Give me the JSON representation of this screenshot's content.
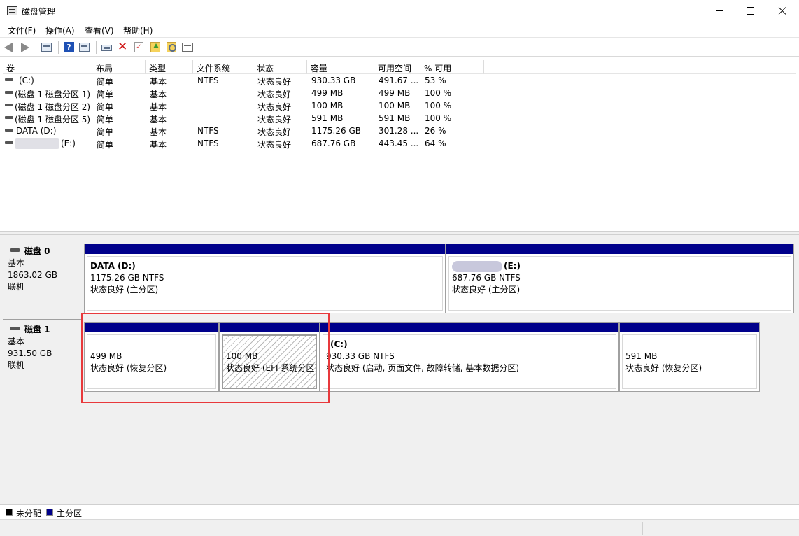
{
  "window": {
    "title": "磁盘管理"
  },
  "menu": [
    "文件(F)",
    "操作(A)",
    "查看(V)",
    "帮助(H)"
  ],
  "toolbar": {
    "icons": [
      "back-arrow",
      "forward-arrow",
      "show-hide-console-tree",
      "help",
      "view-properties",
      "connect-disk",
      "delete",
      "check",
      "folder-up",
      "search-folder",
      "properties"
    ]
  },
  "table": {
    "headers": [
      "卷",
      "布局",
      "类型",
      "文件系统",
      "状态",
      "容量",
      "可用空间",
      "% 可用"
    ],
    "rows": [
      {
        "volume": "(C:)",
        "layout": "简单",
        "type": "基本",
        "fs": "NTFS",
        "status": "状态良好",
        "capacity": "930.33 GB",
        "free": "491.67 ...",
        "pct": "53 %"
      },
      {
        "volume": "(磁盘 1 磁盘分区 1)",
        "layout": "简单",
        "type": "基本",
        "fs": "",
        "status": "状态良好",
        "capacity": "499 MB",
        "free": "499 MB",
        "pct": "100 %"
      },
      {
        "volume": "(磁盘 1 磁盘分区 2)",
        "layout": "简单",
        "type": "基本",
        "fs": "",
        "status": "状态良好",
        "capacity": "100 MB",
        "free": "100 MB",
        "pct": "100 %"
      },
      {
        "volume": "(磁盘 1 磁盘分区 5)",
        "layout": "简单",
        "type": "基本",
        "fs": "",
        "status": "状态良好",
        "capacity": "591 MB",
        "free": "591 MB",
        "pct": "100 %"
      },
      {
        "volume": "DATA (D:)",
        "layout": "简单",
        "type": "基本",
        "fs": "NTFS",
        "status": "状态良好",
        "capacity": "1175.26 GB",
        "free": "301.28 ...",
        "pct": "26 %"
      },
      {
        "volume": "(E:)",
        "layout": "简单",
        "type": "基本",
        "fs": "NTFS",
        "status": "状态良好",
        "capacity": "687.76 GB",
        "free": "443.45 ...",
        "pct": "64 %"
      }
    ]
  },
  "disks": [
    {
      "name": "磁盘 0",
      "type": "基本",
      "size": "1863.02 GB",
      "state": "联机",
      "partitions": [
        {
          "title": "DATA  (D:)",
          "size": "1175.26 GB NTFS",
          "status": "状态良好 (主分区)"
        },
        {
          "title": "(E:)",
          "size": "687.76 GB NTFS",
          "status": "状态良好 (主分区)"
        }
      ]
    },
    {
      "name": "磁盘 1",
      "type": "基本",
      "size": "931.50 GB",
      "state": "联机",
      "partitions": [
        {
          "size": "499 MB",
          "status": "状态良好 (恢复分区)"
        },
        {
          "size": "100 MB",
          "status": "状态良好 (EFI 系统分区)"
        },
        {
          "title": "(C:)",
          "size": "930.33 GB NTFS",
          "status": "状态良好 (启动, 页面文件, 故障转储, 基本数据分区)"
        },
        {
          "size": "591 MB",
          "status": "状态良好 (恢复分区)"
        }
      ]
    }
  ],
  "legend": [
    {
      "label": "未分配",
      "color": "#000000"
    },
    {
      "label": "主分区",
      "color": "#00008b"
    }
  ]
}
